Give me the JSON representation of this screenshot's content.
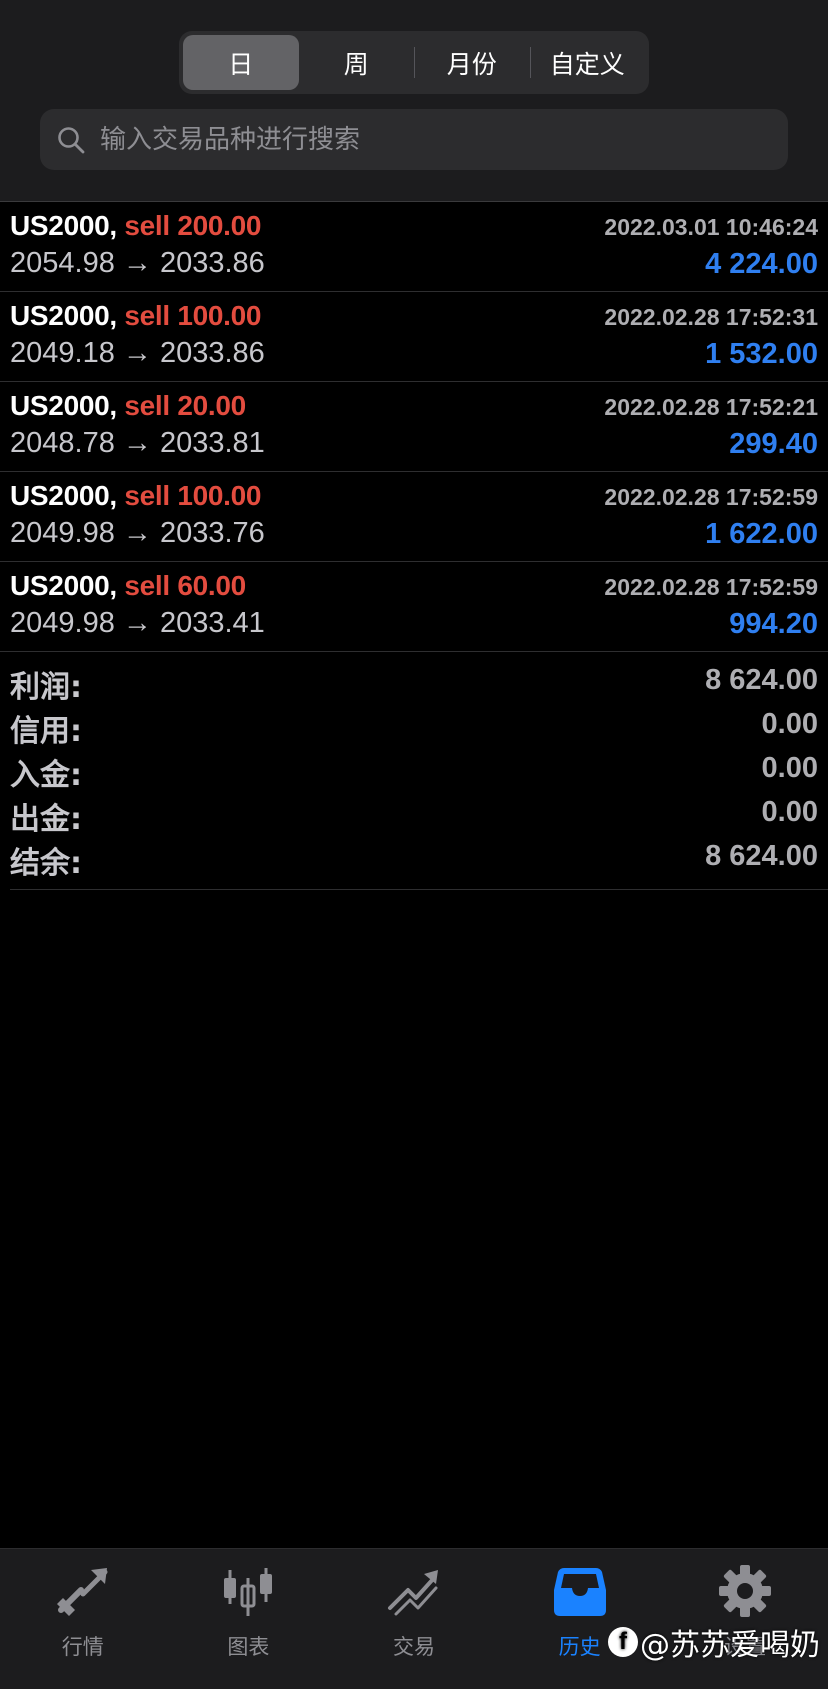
{
  "period_tabs": [
    {
      "label": "日",
      "active": true
    },
    {
      "label": "周",
      "active": false
    },
    {
      "label": "月份",
      "active": false
    },
    {
      "label": "自定义",
      "active": false
    }
  ],
  "search": {
    "placeholder": "输入交易品种进行搜索",
    "value": ""
  },
  "trades": [
    {
      "symbol": "US2000,",
      "side": "sell 200.00",
      "time": "2022.03.01 10:46:24",
      "prices": "2054.98 → 2033.86",
      "profit": "4 224.00"
    },
    {
      "symbol": "US2000,",
      "side": "sell 100.00",
      "time": "2022.02.28 17:52:31",
      "prices": "2049.18 → 2033.86",
      "profit": "1 532.00"
    },
    {
      "symbol": "US2000,",
      "side": "sell 20.00",
      "time": "2022.02.28 17:52:21",
      "prices": "2048.78 → 2033.81",
      "profit": "299.40"
    },
    {
      "symbol": "US2000,",
      "side": "sell 100.00",
      "time": "2022.02.28 17:52:59",
      "prices": "2049.98 → 2033.76",
      "profit": "1 622.00"
    },
    {
      "symbol": "US2000,",
      "side": "sell 60.00",
      "time": "2022.02.28 17:52:59",
      "prices": "2049.98 → 2033.41",
      "profit": "994.20"
    }
  ],
  "summary": [
    {
      "label": "利润:",
      "value": "8 624.00"
    },
    {
      "label": "信用:",
      "value": "0.00"
    },
    {
      "label": "入金:",
      "value": "0.00"
    },
    {
      "label": "出金:",
      "value": "0.00"
    },
    {
      "label": "结余:",
      "value": "8 624.00"
    }
  ],
  "tabbar": [
    {
      "label": "行情",
      "icon": "quotes-icon",
      "active": false
    },
    {
      "label": "图表",
      "icon": "chart-candles-icon",
      "active": false
    },
    {
      "label": "交易",
      "icon": "trade-icon",
      "active": false
    },
    {
      "label": "历史",
      "icon": "history-inbox-icon",
      "active": true
    },
    {
      "label": "设置",
      "icon": "gear-icon",
      "active": false
    }
  ],
  "watermark": {
    "logo": "f",
    "text": "@苏苏爱喝奶"
  },
  "colors": {
    "accent": "#1a82ff",
    "sell": "#e34c3f",
    "profit": "#2f7ff0",
    "background": "#000000",
    "header_bg": "#1c1c1e"
  }
}
